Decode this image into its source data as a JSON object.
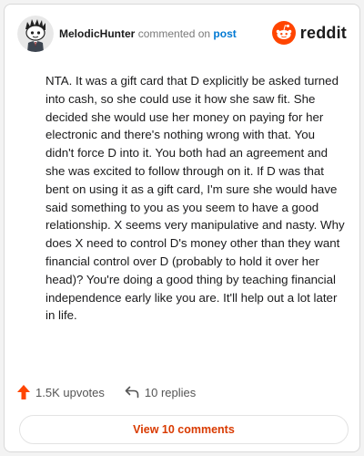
{
  "header": {
    "username": "MelodicHunter",
    "commented_text": "commented on",
    "post_link": "post",
    "brand_name": "reddit"
  },
  "comment": {
    "body": "NTA. It was a gift card that D explicitly be asked turned into cash, so she could use it how she saw fit. She decided she would use her money on paying for her electronic and there's nothing wrong with that. You didn't force D into it. You both had an agreement and she was excited to follow through on it. If D was that bent on using it as a gift card, I'm sure she would have said something to you as you seem to have a good relationship. X seems very manipulative and nasty. Why does X need to control D's money other than they want financial control over D (probably to hold it over her head)? You're doing a good thing by teaching financial independence early like you are. It'll help out a lot later in life."
  },
  "actions": {
    "upvotes_label": "1.5K upvotes",
    "replies_label": "10 replies"
  },
  "footer": {
    "view_comments_label": "View 10 comments"
  },
  "icons": {
    "avatar": "snoo-avatar-icon",
    "brand": "reddit-logo-icon",
    "upvote": "upvote-arrow-icon",
    "reply": "reply-arrow-icon"
  },
  "colors": {
    "username": "#1a1a1b",
    "post_link": "#0079d3",
    "brand_orange": "#ff4500",
    "upvote_arrow": "#ff4500",
    "view_comments_text": "#d93a00",
    "body_text": "#1a1a1b"
  }
}
